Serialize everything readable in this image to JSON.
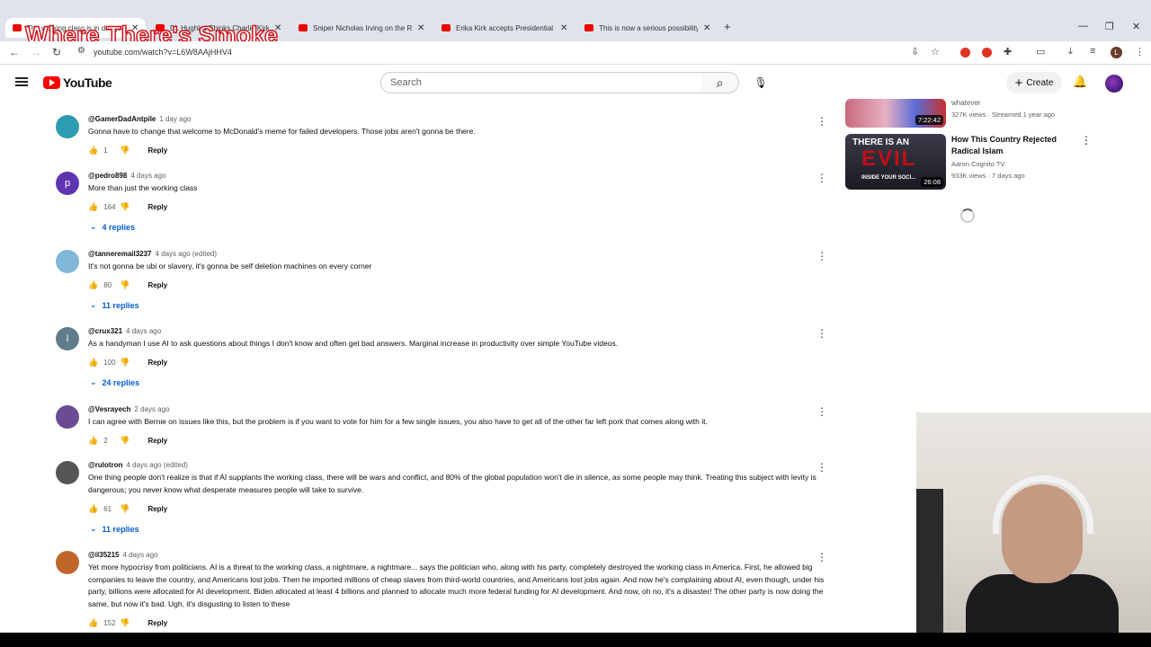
{
  "watermark": "Where There's Smoke",
  "browser": {
    "tabs": [
      {
        "label": "The working class is in danger"
      },
      {
        "label": "DL Hughley Thinks Charlie Kirk"
      },
      {
        "label": "Sniper Nicholas Irving on the Rise"
      },
      {
        "label": "Erika Kirk accepts Presidential Medal"
      },
      {
        "label": "This is now a serious possibility"
      }
    ],
    "new_tab": "+",
    "url": "youtube.com/watch?v=L6W8AAjHHV4"
  },
  "header": {
    "logo": "YouTube",
    "search_placeholder": "Search",
    "create_label": "Create"
  },
  "comments": [
    {
      "user": "@GamerDadAntpile",
      "time": "1 day ago",
      "text": "Gonna have to change that welcome to McDonald's meme for failed developers. Those jobs aren't gonna be there.",
      "likes": "1",
      "reply": "Reply",
      "avatar_color": "#2d9bb0",
      "avatar_letter": ""
    },
    {
      "user": "@pedro898",
      "time": "4 days ago",
      "text": "More than just the working class",
      "likes": "164",
      "reply": "Reply",
      "replies": "4 replies",
      "avatar_color": "#5e35b1",
      "avatar_letter": "p"
    },
    {
      "user": "@tanneremail3237",
      "time": "4 days ago (edited)",
      "text": "It's not gonna be ubi or slavery, it's gonna be self deletion machines on every corner",
      "likes": "80",
      "reply": "Reply",
      "replies": "11 replies",
      "avatar_color": "#7fb7d9",
      "avatar_letter": ""
    },
    {
      "user": "@crux321",
      "time": "4 days ago",
      "text": "As a handyman I use AI to ask questions about things I don't know and often get bad answers. Marginal increase in productivity over simple YouTube videos.",
      "likes": "100",
      "reply": "Reply",
      "replies": "24 replies",
      "avatar_color": "#607d8b",
      "avatar_letter": "I"
    },
    {
      "user": "@Vesrayech",
      "time": "2 days ago",
      "text": "I can agree with Bernie on issues like this, but the problem is if you want to vote for him for a few single issues, you also have to get all of the other far left pork that comes along with it.",
      "likes": "2",
      "reply": "Reply",
      "avatar_color": "#6a4c93",
      "avatar_letter": ""
    },
    {
      "user": "@rulotron",
      "time": "4 days ago (edited)",
      "text": "One thing people don't realize is that if AI supplants the working class, there will be wars and conflict, and 80% of the global population won't die in silence, as some people may think. Treating this subject with levity is dangerous; you never know what desperate measures people will take to survive.",
      "likes": "61",
      "reply": "Reply",
      "replies": "11 replies",
      "avatar_color": "#555",
      "avatar_letter": ""
    },
    {
      "user": "@il35215",
      "time": "4 days ago",
      "text": "Yet more hypocrisy from politicians. AI is a threat to the working class, a nightmare, a nightmare... says the politician who, along with his party, completely destroyed the working class in America. First, he allowed big companies to leave the country, and Americans lost jobs. Then he imported millions of cheap slaves from third-world countries, and Americans lost jobs again. And now he's complaining about AI, even though, under his party, billions were allocated for AI development. Biden allocated at least 4 billions and planned to allocate much more federal funding for AI development. And now, oh no, it's a disaster! The other party is now doing the same, but now it's bad. Ugh, it's disgusting to listen to these",
      "likes": "152",
      "reply": "Reply",
      "avatar_color": "#c0652a",
      "avatar_letter": ""
    }
  ],
  "sidebar": {
    "videos": [
      {
        "title": "",
        "channel": "whatever",
        "meta": "327K views · Streamed 1 year ago",
        "duration": "7:22:42"
      },
      {
        "title": "How This Country Rejected Radical Islam",
        "channel": "Aaron Cognito TV",
        "meta": "933K views · 7 days ago",
        "duration": "26:08",
        "thumb_top": "THERE IS AN",
        "thumb_big": "EVIL",
        "thumb_sub": "INSIDE YOUR SOCI..."
      }
    ]
  }
}
